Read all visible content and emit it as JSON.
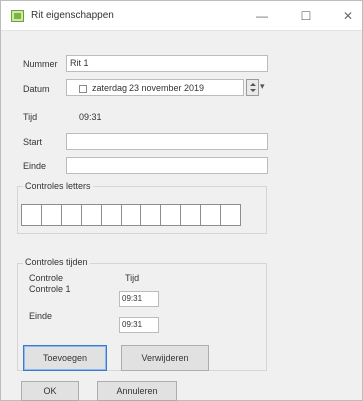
{
  "window": {
    "title": "Rit eigenschappen",
    "minimize_glyph": "—",
    "maximize_glyph": "☐",
    "close_glyph": "✕"
  },
  "form": {
    "nummer_label": "Nummer",
    "nummer_value": "Rit 1",
    "datum_label": "Datum",
    "datum_day": "zaterdag",
    "datum_rest": "23 november 2019",
    "tijd_label": "Tijd",
    "tijd_value": "09:31",
    "start_label": "Start",
    "start_value": "",
    "einde_label": "Einde",
    "einde_value": ""
  },
  "controles_letters": {
    "title": "Controles letters",
    "cells": 11
  },
  "controles_tijden": {
    "title": "Controles tijden",
    "header_controle": "Controle",
    "header_tijd": "Tijd",
    "row1_label": "Controle 1",
    "row1_value": "09:31",
    "row2_label": "Einde",
    "row2_value": "09:31",
    "btn_left": "Toevoegen",
    "btn_right": "Verwijderen"
  },
  "footer": {
    "ok_label": "OK",
    "cancel_label": "Annuleren"
  }
}
